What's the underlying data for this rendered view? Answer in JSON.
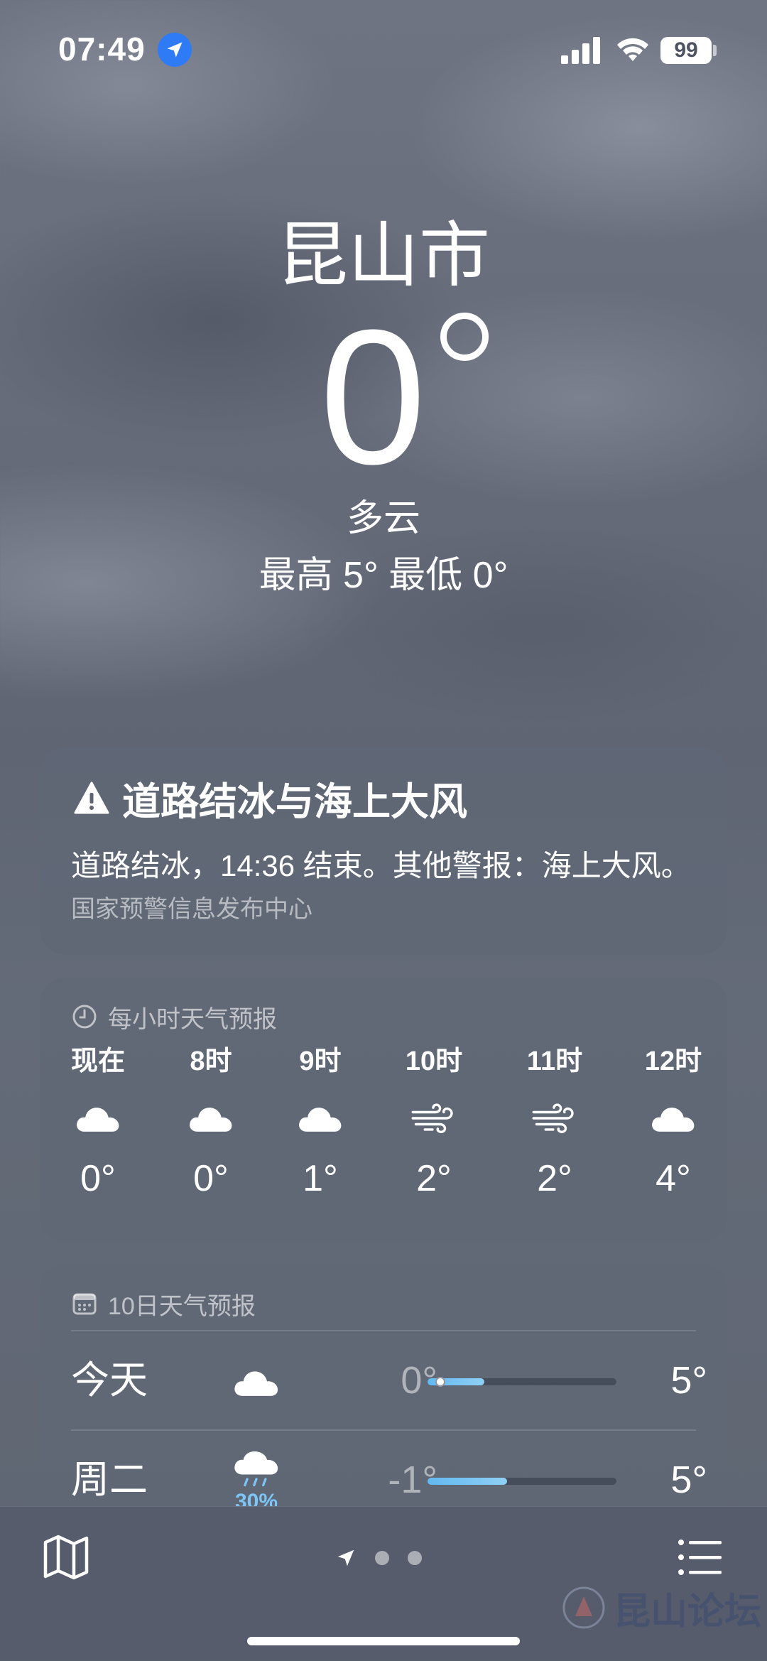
{
  "status_bar": {
    "time": "07:49",
    "battery": "99"
  },
  "location": {
    "city": "昆山市",
    "temperature": "0",
    "condition": "多云",
    "high_low": "最高 5°  最低 0°"
  },
  "alert": {
    "title": "道路结冰与海上大风",
    "text": "道路结冰，14:36 结束。其他警报：海上大风。",
    "source": "国家预警信息发布中心"
  },
  "hourly": {
    "header": "每小时天气预报",
    "items": [
      {
        "time": "现在",
        "icon": "cloud-icon",
        "temp": "0°"
      },
      {
        "time": "8时",
        "icon": "cloud-icon",
        "temp": "0°"
      },
      {
        "time": "9时",
        "icon": "cloud-icon",
        "temp": "1°"
      },
      {
        "time": "10时",
        "icon": "wind-icon",
        "temp": "2°"
      },
      {
        "time": "11时",
        "icon": "wind-icon",
        "temp": "2°"
      },
      {
        "time": "12时",
        "icon": "cloud-icon",
        "temp": "4°"
      }
    ]
  },
  "daily": {
    "header": "10日天气预报",
    "items": [
      {
        "day": "今天",
        "icon": "cloud-icon",
        "precip": "",
        "low": "0°",
        "high": "5°",
        "bar_start": 0.0,
        "bar_end": 0.3,
        "current_marker": 0.04
      },
      {
        "day": "周二",
        "icon": "cloud-rain-icon",
        "precip": "30%",
        "low": "-1°",
        "high": "5°",
        "bar_start": 0.0,
        "bar_end": 0.42
      }
    ]
  },
  "watermark": "昆山论坛",
  "colors": {
    "location_badge": "#2f7bf5",
    "precip_text": "#7cc6f7",
    "temp_bar": "#62b9f2"
  }
}
